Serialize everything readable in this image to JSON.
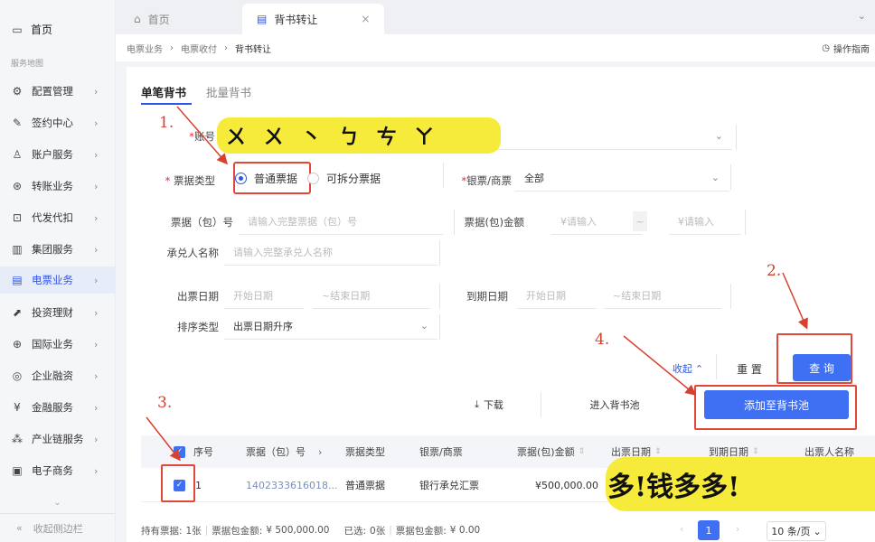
{
  "sidebar": {
    "home": "首页",
    "map_label": "服务地图",
    "items": [
      {
        "label": "配置管理",
        "icon": "gear-icon"
      },
      {
        "label": "签约中心",
        "icon": "pen-icon"
      },
      {
        "label": "账户服务",
        "icon": "user-icon"
      },
      {
        "label": "转账业务",
        "icon": "currency-icon"
      },
      {
        "label": "代发代扣",
        "icon": "import-icon"
      },
      {
        "label": "集团服务",
        "icon": "building-icon"
      },
      {
        "label": "电票业务",
        "icon": "document-icon"
      },
      {
        "label": "投资理财",
        "icon": "chart-icon"
      },
      {
        "label": "国际业务",
        "icon": "globe-icon"
      },
      {
        "label": "企业融资",
        "icon": "target-icon"
      },
      {
        "label": "金融服务",
        "icon": "yen-icon"
      },
      {
        "label": "产业链服务",
        "icon": "nodes-icon"
      },
      {
        "label": "电子商务",
        "icon": "briefcase-icon"
      }
    ],
    "active_index": 6,
    "collapse_label": "收起侧边栏"
  },
  "tabs": [
    {
      "label": "首页",
      "icon": "home-icon"
    },
    {
      "label": "背书转让",
      "icon": "file-icon"
    }
  ],
  "breadcrumb": [
    "电票业务",
    "电票收付",
    "背书转让"
  ],
  "guide_label": "操作指南",
  "subtabs": [
    "单笔背书",
    "批量背书"
  ],
  "form": {
    "account_label": "账号",
    "account_value": "",
    "bill_type_label": "票据类型",
    "bill_type_options": [
      "普通票据",
      "可拆分票据"
    ],
    "bill_type_selected": "普通票据",
    "bank_label": "银票/商票",
    "bank_value": "全部",
    "bill_no_label": "票据（包）号",
    "bill_no_placeholder": "请输入完整票据（包）号",
    "amount_label": "票据(包)金额",
    "amount_min_placeholder": "¥请输入",
    "amount_sep": "~",
    "amount_max_placeholder": "¥请输入",
    "acceptor_label": "承兑人名称",
    "acceptor_placeholder": "请输入完整承兑人名称",
    "issue_date_label": "出票日期",
    "issue_start": "开始日期",
    "issue_end": "~结束日期",
    "due_date_label": "到期日期",
    "due_start": "开始日期",
    "due_end": "~结束日期",
    "sort_label": "排序类型",
    "sort_value": "出票日期升序",
    "collapse_label": "收起",
    "reset_label": "重 置",
    "query_label": "查 询"
  },
  "actions": {
    "download": "下载",
    "enter_pool": "进入背书池",
    "add_pool": "添加至背书池"
  },
  "table": {
    "headers": [
      "序号",
      "票据（包）号",
      "票据类型",
      "银票/商票",
      "票据(包)金额",
      "出票日期",
      "到期日期",
      "出票人名称"
    ],
    "rows": [
      {
        "seq": "1",
        "bill_no": "1402333616018...",
        "bill_type": "普通票据",
        "bank_type": "银行承兑汇票",
        "amount": "¥500,000.00"
      }
    ]
  },
  "footer": {
    "held_label": "持有票据:",
    "held_count": "1张",
    "held_total_label": "票据包金额:",
    "held_total": "¥ 500,000.00",
    "selected_label": "已选:",
    "selected_count": "0张",
    "selected_total_label": "票据包金额:",
    "selected_total": "¥ 0.00",
    "page": "1",
    "page_size": "10 条/页"
  },
  "annotations": {
    "step1": "1.",
    "step2": "2.",
    "step3": "3.",
    "step4": "4.",
    "scribble_bottom": "多!钱多多!"
  },
  "colors": {
    "accent": "#3f6ff2",
    "annotation_red": "#e2483a",
    "highlighter": "#f6ea3a"
  }
}
